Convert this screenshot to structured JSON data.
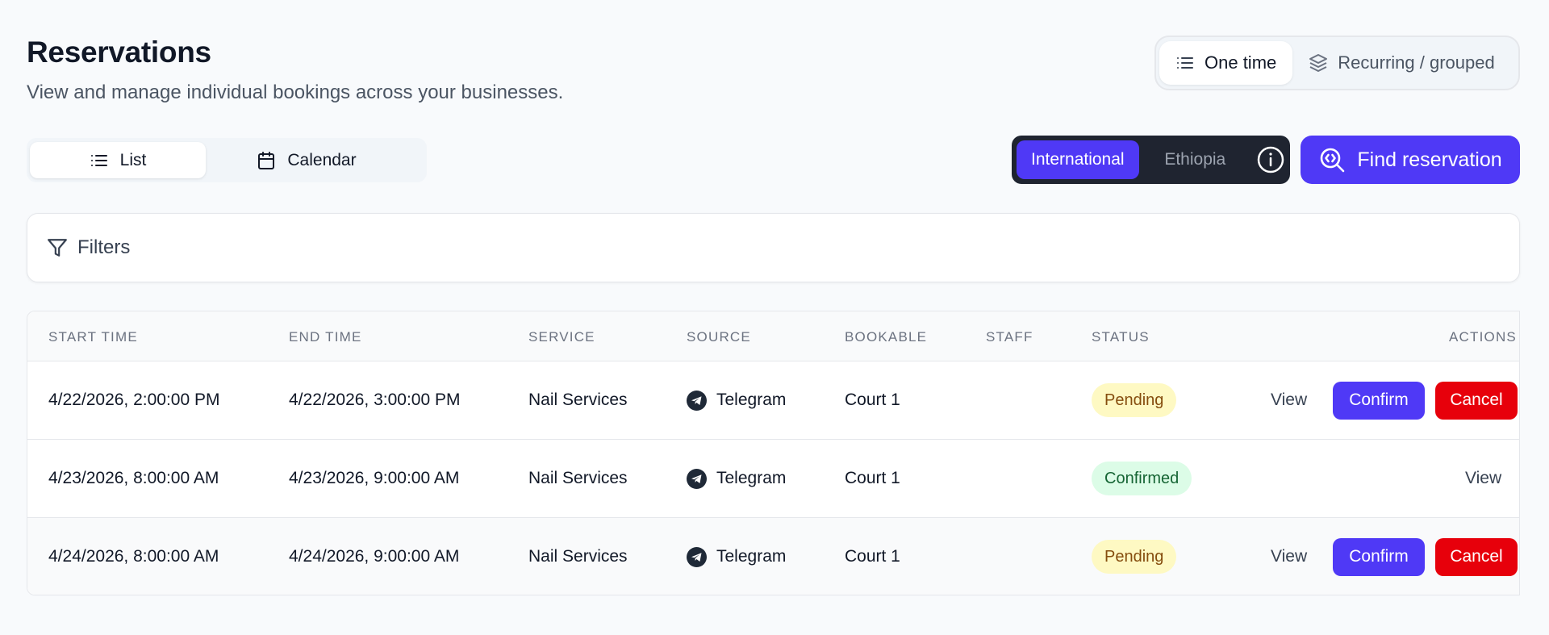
{
  "header": {
    "title": "Reservations",
    "subtitle": "View and manage individual bookings across your businesses."
  },
  "mode_toggle": {
    "one_time": "One time",
    "recurring": "Recurring / grouped",
    "selected": "One time"
  },
  "view_toggle": {
    "list": "List",
    "calendar": "Calendar",
    "selected": "List"
  },
  "region_toggle": {
    "international": "International",
    "ethiopia": "Ethiopia",
    "selected": "International"
  },
  "find_button": {
    "label": "Find reservation"
  },
  "filters": {
    "label": "Filters"
  },
  "table": {
    "columns": {
      "start_time": "START TIME",
      "end_time": "END TIME",
      "service": "SERVICE",
      "source": "SOURCE",
      "bookable": "BOOKABLE",
      "staff": "STAFF",
      "status": "STATUS",
      "actions": "ACTIONS"
    },
    "rows": [
      {
        "start_time": "4/22/2026, 2:00:00 PM",
        "end_time": "4/22/2026, 3:00:00 PM",
        "service": "Nail Services",
        "source": "Telegram",
        "bookable": "Court 1",
        "staff": "",
        "status": "Pending",
        "view": "View",
        "confirm": "Confirm",
        "cancel": "Cancel"
      },
      {
        "start_time": "4/23/2026, 8:00:00 AM",
        "end_time": "4/23/2026, 9:00:00 AM",
        "service": "Nail Services",
        "source": "Telegram",
        "bookable": "Court 1",
        "staff": "",
        "status": "Confirmed",
        "view": "View"
      },
      {
        "start_time": "4/24/2026, 8:00:00 AM",
        "end_time": "4/24/2026, 9:00:00 AM",
        "service": "Nail Services",
        "source": "Telegram",
        "bookable": "Court 1",
        "staff": "",
        "status": "Pending",
        "view": "View",
        "confirm": "Confirm",
        "cancel": "Cancel"
      }
    ]
  },
  "colors": {
    "accent": "#4f39f6",
    "danger": "#e7000b",
    "pending_bg": "#fef9c3",
    "confirmed_bg": "#dcfce7"
  },
  "icons": {
    "mode_one_time": "list-icon",
    "mode_recurring": "layers-icon",
    "view_list": "list-icon",
    "view_calendar": "calendar-icon",
    "region_info": "info-icon",
    "find": "search-icon",
    "filters": "filter-icon",
    "source": "telegram-icon"
  }
}
